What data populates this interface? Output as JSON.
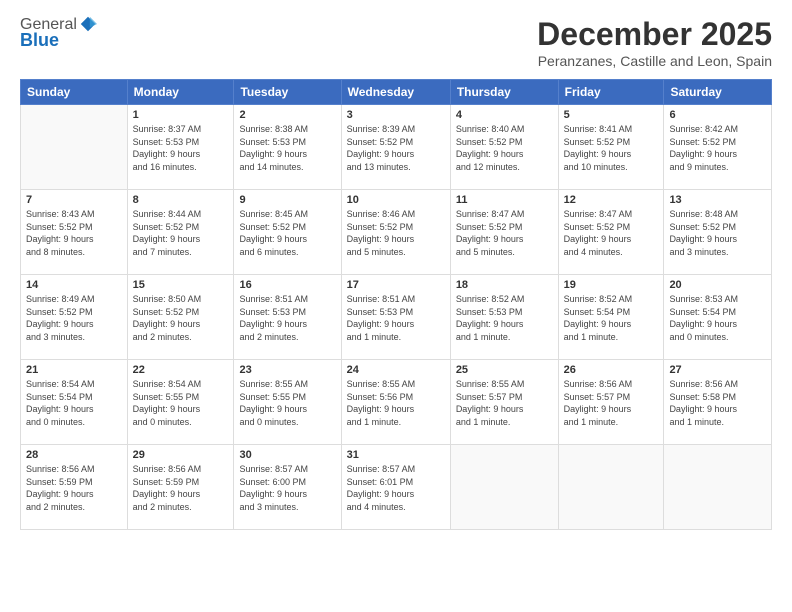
{
  "logo": {
    "general": "General",
    "blue": "Blue"
  },
  "title": "December 2025",
  "subtitle": "Peranzanes, Castille and Leon, Spain",
  "days": [
    "Sunday",
    "Monday",
    "Tuesday",
    "Wednesday",
    "Thursday",
    "Friday",
    "Saturday"
  ],
  "weeks": [
    [
      {
        "day": "",
        "info": ""
      },
      {
        "day": "1",
        "info": "Sunrise: 8:37 AM\nSunset: 5:53 PM\nDaylight: 9 hours\nand 16 minutes."
      },
      {
        "day": "2",
        "info": "Sunrise: 8:38 AM\nSunset: 5:53 PM\nDaylight: 9 hours\nand 14 minutes."
      },
      {
        "day": "3",
        "info": "Sunrise: 8:39 AM\nSunset: 5:52 PM\nDaylight: 9 hours\nand 13 minutes."
      },
      {
        "day": "4",
        "info": "Sunrise: 8:40 AM\nSunset: 5:52 PM\nDaylight: 9 hours\nand 12 minutes."
      },
      {
        "day": "5",
        "info": "Sunrise: 8:41 AM\nSunset: 5:52 PM\nDaylight: 9 hours\nand 10 minutes."
      },
      {
        "day": "6",
        "info": "Sunrise: 8:42 AM\nSunset: 5:52 PM\nDaylight: 9 hours\nand 9 minutes."
      }
    ],
    [
      {
        "day": "7",
        "info": "Sunrise: 8:43 AM\nSunset: 5:52 PM\nDaylight: 9 hours\nand 8 minutes."
      },
      {
        "day": "8",
        "info": "Sunrise: 8:44 AM\nSunset: 5:52 PM\nDaylight: 9 hours\nand 7 minutes."
      },
      {
        "day": "9",
        "info": "Sunrise: 8:45 AM\nSunset: 5:52 PM\nDaylight: 9 hours\nand 6 minutes."
      },
      {
        "day": "10",
        "info": "Sunrise: 8:46 AM\nSunset: 5:52 PM\nDaylight: 9 hours\nand 5 minutes."
      },
      {
        "day": "11",
        "info": "Sunrise: 8:47 AM\nSunset: 5:52 PM\nDaylight: 9 hours\nand 5 minutes."
      },
      {
        "day": "12",
        "info": "Sunrise: 8:47 AM\nSunset: 5:52 PM\nDaylight: 9 hours\nand 4 minutes."
      },
      {
        "day": "13",
        "info": "Sunrise: 8:48 AM\nSunset: 5:52 PM\nDaylight: 9 hours\nand 3 minutes."
      }
    ],
    [
      {
        "day": "14",
        "info": "Sunrise: 8:49 AM\nSunset: 5:52 PM\nDaylight: 9 hours\nand 3 minutes."
      },
      {
        "day": "15",
        "info": "Sunrise: 8:50 AM\nSunset: 5:52 PM\nDaylight: 9 hours\nand 2 minutes."
      },
      {
        "day": "16",
        "info": "Sunrise: 8:51 AM\nSunset: 5:53 PM\nDaylight: 9 hours\nand 2 minutes."
      },
      {
        "day": "17",
        "info": "Sunrise: 8:51 AM\nSunset: 5:53 PM\nDaylight: 9 hours\nand 1 minute."
      },
      {
        "day": "18",
        "info": "Sunrise: 8:52 AM\nSunset: 5:53 PM\nDaylight: 9 hours\nand 1 minute."
      },
      {
        "day": "19",
        "info": "Sunrise: 8:52 AM\nSunset: 5:54 PM\nDaylight: 9 hours\nand 1 minute."
      },
      {
        "day": "20",
        "info": "Sunrise: 8:53 AM\nSunset: 5:54 PM\nDaylight: 9 hours\nand 0 minutes."
      }
    ],
    [
      {
        "day": "21",
        "info": "Sunrise: 8:54 AM\nSunset: 5:54 PM\nDaylight: 9 hours\nand 0 minutes."
      },
      {
        "day": "22",
        "info": "Sunrise: 8:54 AM\nSunset: 5:55 PM\nDaylight: 9 hours\nand 0 minutes."
      },
      {
        "day": "23",
        "info": "Sunrise: 8:55 AM\nSunset: 5:55 PM\nDaylight: 9 hours\nand 0 minutes."
      },
      {
        "day": "24",
        "info": "Sunrise: 8:55 AM\nSunset: 5:56 PM\nDaylight: 9 hours\nand 1 minute."
      },
      {
        "day": "25",
        "info": "Sunrise: 8:55 AM\nSunset: 5:57 PM\nDaylight: 9 hours\nand 1 minute."
      },
      {
        "day": "26",
        "info": "Sunrise: 8:56 AM\nSunset: 5:57 PM\nDaylight: 9 hours\nand 1 minute."
      },
      {
        "day": "27",
        "info": "Sunrise: 8:56 AM\nSunset: 5:58 PM\nDaylight: 9 hours\nand 1 minute."
      }
    ],
    [
      {
        "day": "28",
        "info": "Sunrise: 8:56 AM\nSunset: 5:59 PM\nDaylight: 9 hours\nand 2 minutes."
      },
      {
        "day": "29",
        "info": "Sunrise: 8:56 AM\nSunset: 5:59 PM\nDaylight: 9 hours\nand 2 minutes."
      },
      {
        "day": "30",
        "info": "Sunrise: 8:57 AM\nSunset: 6:00 PM\nDaylight: 9 hours\nand 3 minutes."
      },
      {
        "day": "31",
        "info": "Sunrise: 8:57 AM\nSunset: 6:01 PM\nDaylight: 9 hours\nand 4 minutes."
      },
      {
        "day": "",
        "info": ""
      },
      {
        "day": "",
        "info": ""
      },
      {
        "day": "",
        "info": ""
      }
    ]
  ]
}
